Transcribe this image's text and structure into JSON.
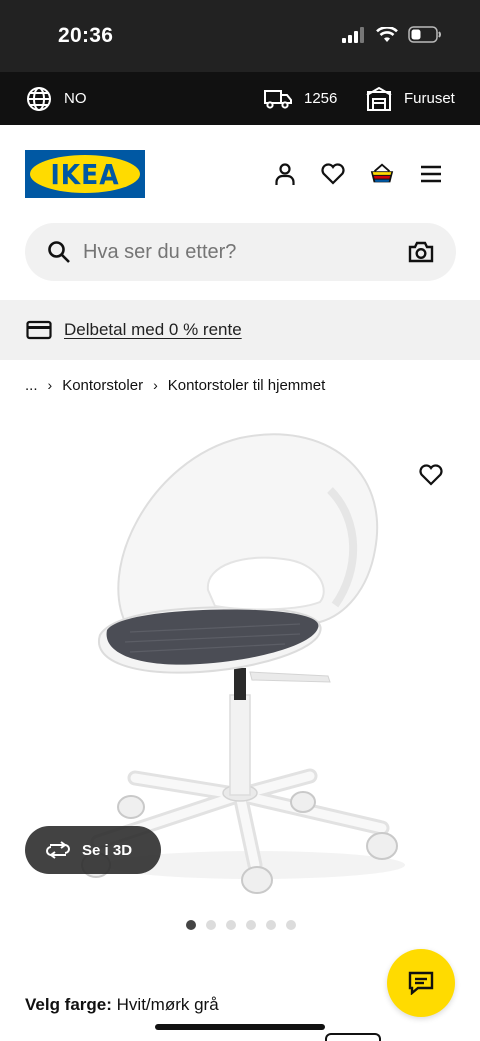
{
  "status_bar": {
    "time": "20:36"
  },
  "top_bar": {
    "language": "NO",
    "delivery_postcode": "1256",
    "store": "Furuset"
  },
  "header": {
    "logo_text": "IKEA",
    "icons": [
      "person-icon",
      "heart-icon",
      "basket-icon",
      "menu-icon"
    ]
  },
  "search": {
    "placeholder": "Hva ser du etter?"
  },
  "promo": {
    "text": "Delbetal med 0 % rente"
  },
  "breadcrumb": {
    "ellipsis": "...",
    "items": [
      "Kontorstoler",
      "Kontorstoler til hjemmet"
    ]
  },
  "product": {
    "view_3d_label": "Se i 3D",
    "image_count": 6,
    "active_image": 1,
    "color_label": "Velg farge:",
    "color_value": "Hvit/mørk grå"
  },
  "colors": {
    "ikea_blue": "#0058a3",
    "ikea_yellow": "#ffdb00"
  }
}
